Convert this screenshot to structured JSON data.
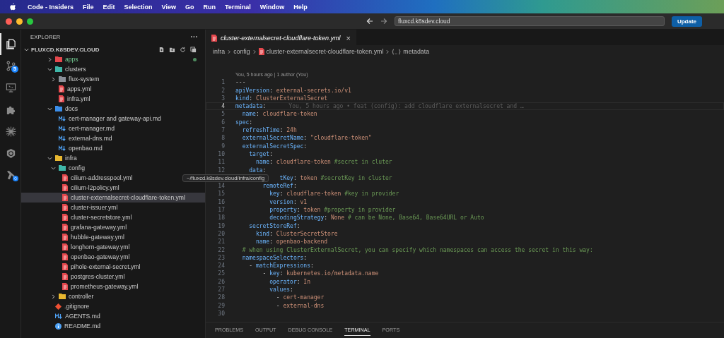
{
  "menu_bar": {
    "app_name": "Code - Insiders",
    "items": [
      "File",
      "Edit",
      "Selection",
      "View",
      "Go",
      "Run",
      "Terminal",
      "Window",
      "Help"
    ]
  },
  "title_bar": {
    "address": "fluxcd.k8sdev.cloud",
    "button": "Update"
  },
  "activity_bar": {
    "items": [
      {
        "kind": "files",
        "selected": true
      },
      {
        "kind": "source-control",
        "selected": false,
        "badge": "5"
      },
      {
        "kind": "remote",
        "selected": false
      },
      {
        "kind": "extensions",
        "selected": false
      },
      {
        "kind": "burst",
        "selected": false
      },
      {
        "kind": "wheel",
        "selected": false
      },
      {
        "kind": "tools",
        "selected": false
      }
    ]
  },
  "sidebar": {
    "title": "EXPLORER",
    "more": "···",
    "root": "FLUXCD.K8SDEV.CLOUD",
    "tree": [
      {
        "name": "apps",
        "kind": "folder",
        "color": "#e5484d",
        "expanded": false,
        "selected": false,
        "modified": true
      },
      {
        "name": "clusters",
        "kind": "folder",
        "color": "#3fb6a8",
        "expanded": true,
        "selected": false,
        "modified": false,
        "children": [
          {
            "name": "flux-system",
            "kind": "folder",
            "color": "#8a8f98",
            "expanded": false,
            "selected": false,
            "modified": false
          },
          {
            "name": "apps.yml",
            "kind": "yaml",
            "selected": false,
            "modified": false
          },
          {
            "name": "infra.yml",
            "kind": "yaml",
            "selected": false,
            "modified": false
          }
        ]
      },
      {
        "name": "docs",
        "kind": "folder",
        "color": "#3b8eea",
        "expanded": true,
        "selected": false,
        "modified": false,
        "children": [
          {
            "name": "cert-manager and gateway-api.md",
            "kind": "markdown",
            "selected": false,
            "modified": false
          },
          {
            "name": "cert-manager.md",
            "kind": "markdown",
            "selected": false,
            "modified": false
          },
          {
            "name": "external-dns.md",
            "kind": "markdown",
            "selected": false,
            "modified": false
          },
          {
            "name": "openbao.md",
            "kind": "markdown",
            "selected": false,
            "modified": false
          }
        ]
      },
      {
        "name": "infra",
        "kind": "folder",
        "color": "#e8b730",
        "expanded": true,
        "selected": false,
        "modified": false,
        "children": [
          {
            "name": "config",
            "kind": "folder",
            "color": "#3fb6a8",
            "expanded": true,
            "selected": false,
            "modified": false,
            "children": [
              {
                "name": "cilium-addresspool.yml",
                "kind": "yaml",
                "selected": false,
                "modified": false
              },
              {
                "name": "cilium-l2policy.yml",
                "kind": "yaml",
                "selected": false,
                "modified": false
              },
              {
                "name": "cluster-externalsecret-cloudflare-token.yml",
                "kind": "yaml",
                "selected": true,
                "modified": false
              },
              {
                "name": "cluster-issuer.yml",
                "kind": "yaml",
                "selected": false,
                "modified": false
              },
              {
                "name": "cluster-secretstore.yml",
                "kind": "yaml",
                "selected": false,
                "modified": false
              },
              {
                "name": "grafana-gateway.yml",
                "kind": "yaml",
                "selected": false,
                "modified": false
              },
              {
                "name": "hubble-gateway.yml",
                "kind": "yaml",
                "selected": false,
                "modified": false
              },
              {
                "name": "longhorn-gateway.yml",
                "kind": "yaml",
                "selected": false,
                "modified": false
              },
              {
                "name": "openbao-gateway.yml",
                "kind": "yaml",
                "selected": false,
                "modified": false
              },
              {
                "name": "pihole-external-secret.yml",
                "kind": "yaml",
                "selected": false,
                "modified": false
              },
              {
                "name": "postgres-cluster.yml",
                "kind": "yaml",
                "selected": false,
                "modified": false
              },
              {
                "name": "prometheus-gateway.yml",
                "kind": "yaml",
                "selected": false,
                "modified": false
              }
            ]
          },
          {
            "name": "controller",
            "kind": "folder",
            "color": "#e8b730",
            "expanded": false,
            "selected": false,
            "modified": false
          }
        ]
      },
      {
        "name": ".gitignore",
        "kind": "git",
        "selected": false,
        "modified": false
      },
      {
        "name": "AGENTS.md",
        "kind": "markdown",
        "selected": false,
        "modified": false
      },
      {
        "name": "README.md",
        "kind": "info",
        "selected": false,
        "modified": false
      }
    ]
  },
  "tooltip": "~/fluxcd.k8sdev.cloud/infra/config",
  "editor": {
    "tab": {
      "title": "cluster-externalsecret-cloudflare-token.yml",
      "close": "×"
    },
    "breadcrumbs": [
      "infra",
      "config",
      "cluster-externalsecret-cloudflare-token.yml",
      "metadata"
    ],
    "code_lens": "You, 5 hours ago | 1 author (You)",
    "lines": [
      {
        "number": "1",
        "current": false,
        "tokens": [
          {
            "kind": "punc",
            "text": "---"
          }
        ]
      },
      {
        "number": "2",
        "current": false,
        "tokens": [
          {
            "kind": "key",
            "text": "apiVersion"
          },
          {
            "kind": "punc",
            "text": ": "
          },
          {
            "kind": "value",
            "text": "external-secrets.io/v1"
          }
        ]
      },
      {
        "number": "3",
        "current": false,
        "tokens": [
          {
            "kind": "key",
            "text": "kind"
          },
          {
            "kind": "punc",
            "text": ": "
          },
          {
            "kind": "value",
            "text": "ClusterExternalSecret"
          }
        ]
      },
      {
        "number": "4",
        "current": true,
        "tokens": [
          {
            "kind": "key",
            "text": "metadata"
          },
          {
            "kind": "punc",
            "text": ":"
          }
        ],
        "blame": "You, 5 hours ago • feat (config): add cloudflare externalsecret and …"
      },
      {
        "number": "5",
        "current": false,
        "tokens": [
          {
            "kind": "key",
            "text": "  name"
          },
          {
            "kind": "punc",
            "text": ": "
          },
          {
            "kind": "value",
            "text": "cloudflare-token"
          }
        ]
      },
      {
        "number": "6",
        "current": false,
        "tokens": [
          {
            "kind": "key",
            "text": "spec"
          },
          {
            "kind": "punc",
            "text": ":"
          }
        ]
      },
      {
        "number": "7",
        "current": false,
        "tokens": [
          {
            "kind": "key",
            "text": "  refreshTime"
          },
          {
            "kind": "punc",
            "text": ": "
          },
          {
            "kind": "value",
            "text": "24h"
          }
        ]
      },
      {
        "number": "8",
        "current": false,
        "tokens": [
          {
            "kind": "key",
            "text": "  externalSecretName"
          },
          {
            "kind": "punc",
            "text": ": "
          },
          {
            "kind": "value",
            "text": "\"cloudflare-token\""
          }
        ]
      },
      {
        "number": "9",
        "current": false,
        "tokens": [
          {
            "kind": "key",
            "text": "  externalSecretSpec"
          },
          {
            "kind": "punc",
            "text": ":"
          }
        ]
      },
      {
        "number": "10",
        "current": false,
        "tokens": [
          {
            "kind": "key",
            "text": "    target"
          },
          {
            "kind": "punc",
            "text": ":"
          }
        ]
      },
      {
        "number": "11",
        "current": false,
        "tokens": [
          {
            "kind": "key",
            "text": "      name"
          },
          {
            "kind": "punc",
            "text": ": "
          },
          {
            "kind": "value",
            "text": "cloudflare-token "
          },
          {
            "kind": "comment",
            "text": "#secret in cluter"
          }
        ]
      },
      {
        "number": "12",
        "current": false,
        "tokens": [
          {
            "kind": "key",
            "text": "    data"
          },
          {
            "kind": "punc",
            "text": ":"
          }
        ]
      },
      {
        "current": false,
        "tokens": [
          {
            "kind": "key",
            "text": "             tKey"
          },
          {
            "kind": "punc",
            "text": ": "
          },
          {
            "kind": "value",
            "text": "token "
          },
          {
            "kind": "comment",
            "text": "#secretKey in cluster"
          }
        ]
      },
      {
        "number": "14",
        "current": false,
        "tokens": [
          {
            "kind": "key",
            "text": "        remoteRef"
          },
          {
            "kind": "punc",
            "text": ":"
          }
        ]
      },
      {
        "number": "15",
        "current": false,
        "tokens": [
          {
            "kind": "key",
            "text": "          key"
          },
          {
            "kind": "punc",
            "text": ": "
          },
          {
            "kind": "value",
            "text": "cloudflare-token "
          },
          {
            "kind": "comment",
            "text": "#key in provider"
          }
        ]
      },
      {
        "number": "16",
        "current": false,
        "tokens": [
          {
            "kind": "key",
            "text": "          version"
          },
          {
            "kind": "punc",
            "text": ": "
          },
          {
            "kind": "value",
            "text": "v1"
          }
        ]
      },
      {
        "number": "17",
        "current": false,
        "tokens": [
          {
            "kind": "key",
            "text": "          property"
          },
          {
            "kind": "punc",
            "text": ": "
          },
          {
            "kind": "value",
            "text": "token "
          },
          {
            "kind": "comment",
            "text": "#property in provider"
          }
        ]
      },
      {
        "number": "18",
        "current": false,
        "tokens": [
          {
            "kind": "key",
            "text": "          decodingStrategy"
          },
          {
            "kind": "punc",
            "text": ": "
          },
          {
            "kind": "value",
            "text": "None "
          },
          {
            "kind": "comment",
            "text": "# can be None, Base64, Base64URL or Auto"
          }
        ]
      },
      {
        "number": "19",
        "current": false,
        "tokens": [
          {
            "kind": "key",
            "text": "    secretStoreRef"
          },
          {
            "kind": "punc",
            "text": ":"
          }
        ]
      },
      {
        "number": "20",
        "current": false,
        "tokens": [
          {
            "kind": "key",
            "text": "      kind"
          },
          {
            "kind": "punc",
            "text": ": "
          },
          {
            "kind": "value",
            "text": "ClusterSecretStore"
          }
        ]
      },
      {
        "number": "21",
        "current": false,
        "tokens": [
          {
            "kind": "key",
            "text": "      name"
          },
          {
            "kind": "punc",
            "text": ": "
          },
          {
            "kind": "value",
            "text": "openbao-backend"
          }
        ]
      },
      {
        "number": "22",
        "current": false,
        "tokens": [
          {
            "kind": "comment",
            "text": "  # when using ClusterExternalSecret, you can specify which namespaces can access the secret in this way:"
          }
        ]
      },
      {
        "number": "23",
        "current": false,
        "tokens": [
          {
            "kind": "key",
            "text": "  namespaceSelectors"
          },
          {
            "kind": "punc",
            "text": ":"
          }
        ]
      },
      {
        "number": "24",
        "current": false,
        "tokens": [
          {
            "kind": "punc",
            "text": "    - "
          },
          {
            "kind": "key",
            "text": "matchExpressions"
          },
          {
            "kind": "punc",
            "text": ":"
          }
        ]
      },
      {
        "number": "25",
        "current": false,
        "tokens": [
          {
            "kind": "punc",
            "text": "        - "
          },
          {
            "kind": "key",
            "text": "key"
          },
          {
            "kind": "punc",
            "text": ": "
          },
          {
            "kind": "value",
            "text": "kubernetes.io/metadata.name"
          }
        ]
      },
      {
        "number": "26",
        "current": false,
        "tokens": [
          {
            "kind": "key",
            "text": "          operator"
          },
          {
            "kind": "punc",
            "text": ": "
          },
          {
            "kind": "value",
            "text": "In"
          }
        ]
      },
      {
        "number": "27",
        "current": false,
        "tokens": [
          {
            "kind": "key",
            "text": "          values"
          },
          {
            "kind": "punc",
            "text": ":"
          }
        ]
      },
      {
        "number": "28",
        "current": false,
        "tokens": [
          {
            "kind": "punc",
            "text": "            - "
          },
          {
            "kind": "value",
            "text": "cert-manager"
          }
        ]
      },
      {
        "number": "29",
        "current": false,
        "tokens": [
          {
            "kind": "punc",
            "text": "            - "
          },
          {
            "kind": "value",
            "text": "external-dns"
          }
        ]
      },
      {
        "number": "30",
        "current": false
      }
    ]
  },
  "panel": {
    "tabs": [
      {
        "label": "PROBLEMS",
        "selected": false
      },
      {
        "label": "OUTPUT",
        "selected": false
      },
      {
        "label": "DEBUG CONSOLE",
        "selected": false
      },
      {
        "label": "TERMINAL",
        "selected": true
      },
      {
        "label": "PORTS",
        "selected": false
      }
    ]
  }
}
